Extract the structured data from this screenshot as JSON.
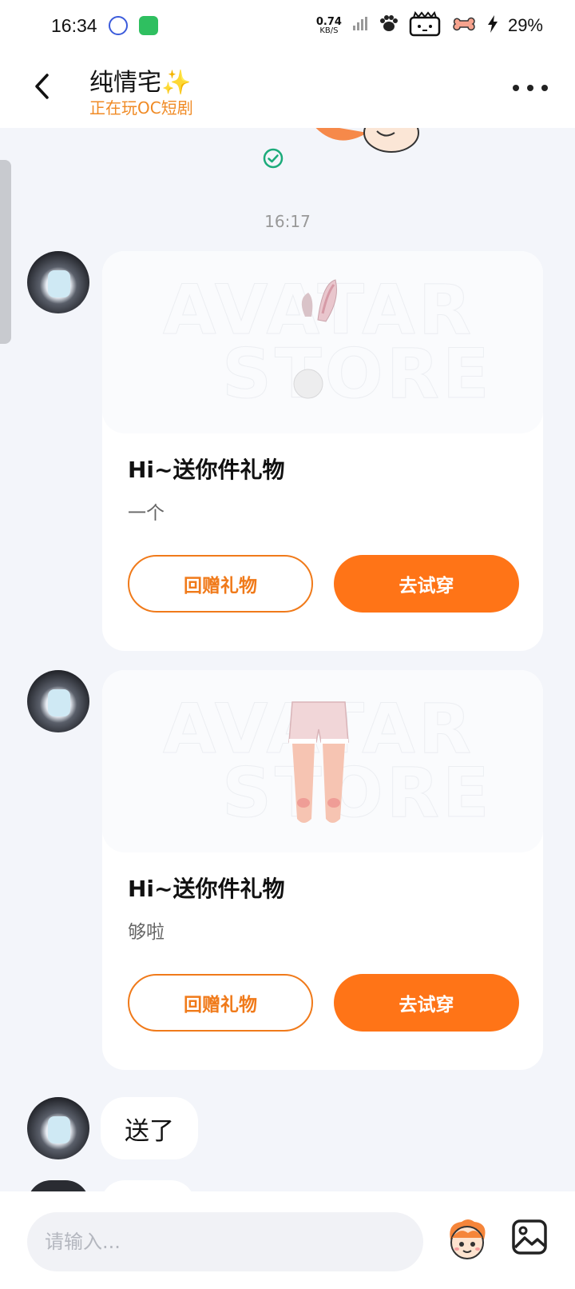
{
  "status_bar": {
    "time": "16:34",
    "net_speed_value": "0.74",
    "net_speed_unit": "KB/S",
    "battery_percent": "29%"
  },
  "header": {
    "contact_name": "纯情宅✨",
    "contact_status": "正在玩OC短剧"
  },
  "chat": {
    "timestamp": "16:17",
    "gift_cards": [
      {
        "title": "Hi~送你件礼物",
        "note": "一个",
        "return_gift_label": "回赠礼物",
        "try_on_label": "去试穿",
        "item_icon": "bunny-ears-tail"
      },
      {
        "title": "Hi~送你件礼物",
        "note": "够啦",
        "return_gift_label": "回赠礼物",
        "try_on_label": "去试穿",
        "item_icon": "pink-shorts"
      }
    ],
    "text_message": "送了"
  },
  "input_bar": {
    "placeholder": "请输入..."
  },
  "colors": {
    "accent_orange": "#ff7417",
    "status_orange": "#f08a24",
    "read_check_green": "#1bab7a",
    "background": "#f3f5fa"
  }
}
